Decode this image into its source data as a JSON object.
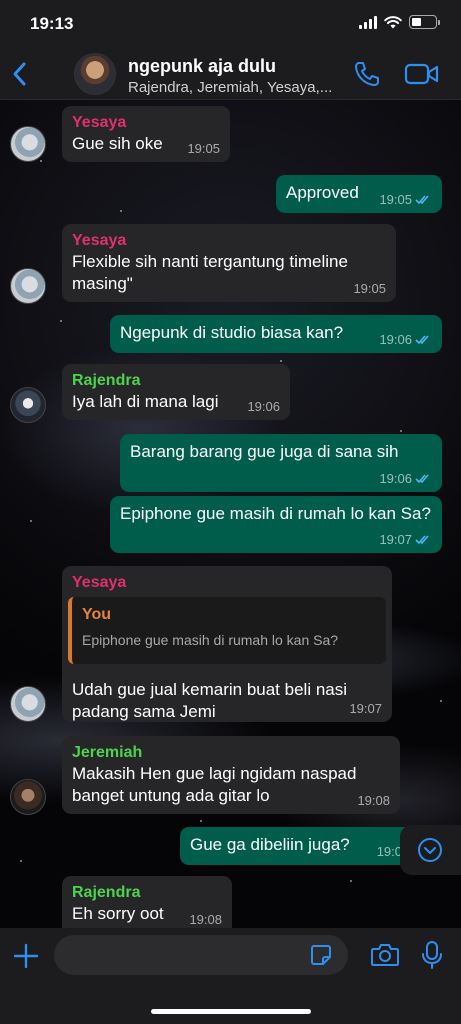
{
  "status": {
    "time": "19:13"
  },
  "header": {
    "title": "ngepunk aja dulu",
    "subtitle": "Rajendra, Jeremiah, Yesaya,..."
  },
  "colors": {
    "accent": "#2f8ef0",
    "outgoing_bubble": "#005c4b",
    "incoming_bubble": "#262628",
    "yesaya": "#e0306c",
    "rajendra": "#4ed34e",
    "jeremiah": "#4ed34e",
    "quote_bar": "#d9792f"
  },
  "messages": [
    {
      "sender": "Yesaya",
      "text": "Gue sih oke",
      "time": "19:05"
    },
    {
      "text": "Approved",
      "time": "19:05"
    },
    {
      "sender": "Yesaya",
      "text": "Flexible sih nanti tergantung timeline masing\"",
      "time": "19:05"
    },
    {
      "text": "Ngepunk di studio biasa kan?",
      "time": "19:06"
    },
    {
      "sender": "Rajendra",
      "text": "Iya lah di mana lagi",
      "time": "19:06"
    },
    {
      "text": "Barang barang gue juga di sana sih",
      "time": "19:06"
    },
    {
      "text": "Epiphone gue masih di rumah lo kan Sa?",
      "time": "19:07"
    },
    {
      "sender": "Yesaya",
      "quote_author": "You",
      "quote_text": "Epiphone gue masih di rumah lo kan Sa?",
      "text": "Udah gue jual kemarin buat beli nasi padang sama Jemi",
      "time": "19:07"
    },
    {
      "sender": "Jeremiah",
      "text": "Makasih Hen gue lagi ngidam naspad banget untung ada gitar lo",
      "time": "19:08"
    },
    {
      "text": "Gue ga dibeliin juga?",
      "time": "19:0"
    },
    {
      "sender": "Rajendra",
      "text": "Eh sorry oot",
      "time": "19:08"
    }
  ],
  "input": {
    "placeholder": ""
  },
  "icons": {
    "back": "chevron-left-icon",
    "call": "phone-icon",
    "video": "video-camera-icon",
    "plus": "plus-icon",
    "sticker": "sticker-icon",
    "camera": "camera-icon",
    "mic": "microphone-icon",
    "scroll": "chevron-down-circle-icon"
  }
}
